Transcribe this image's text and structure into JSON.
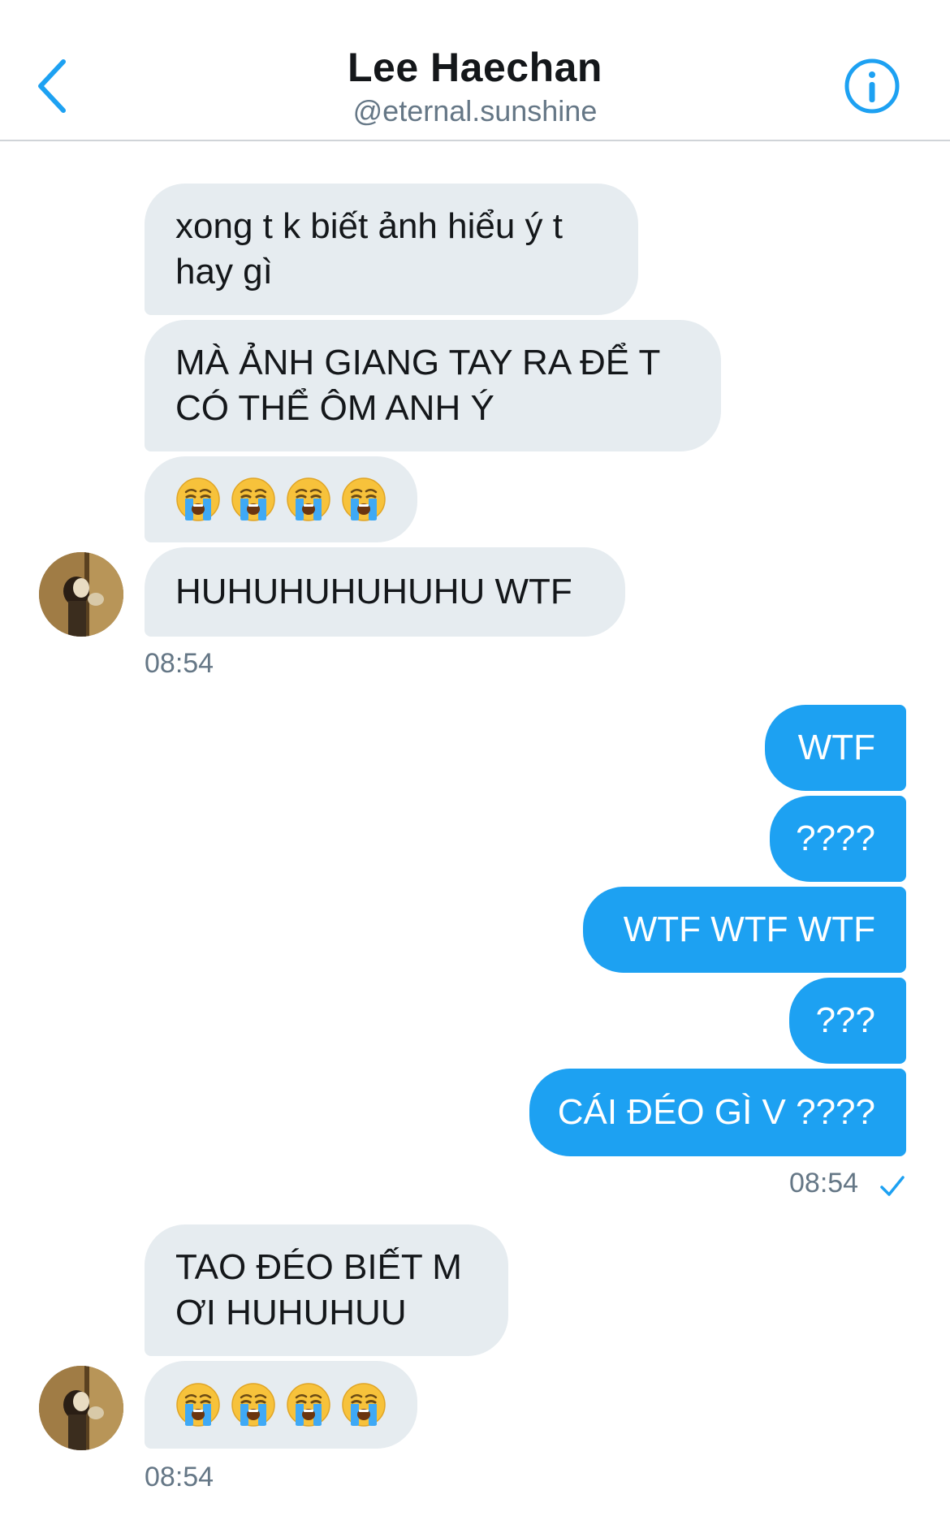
{
  "header": {
    "title": "Lee Haechan",
    "handle": "@eternal.sunshine"
  },
  "messages": {
    "m1": "xong t k biết ảnh hiểu ý t\nhay gì",
    "m2": "MÀ ẢNH GIANG TAY RA ĐỂ T\nCÓ THỂ ÔM ANH Ý",
    "m4": "HUHUHUHUHUHU WTF",
    "t1": "08:54",
    "o1": "WTF",
    "o2": "????",
    "o3": "WTF WTF WTF",
    "o4": "???",
    "o5": "CÁI ĐÉO GÌ V ????",
    "t2": "08:54",
    "m5": "TAO ĐÉO BIẾT M\nƠI HUHUHUU",
    "t3": "08:54"
  },
  "icons": {
    "back": "chevron-left-icon",
    "info": "info-circle-icon",
    "emoji": "loudly-crying-face-emoji",
    "read": "checkmark-icon"
  },
  "colors": {
    "accent": "#1da1f2",
    "incoming_bubble": "#e6ecf0",
    "muted": "#657786"
  }
}
